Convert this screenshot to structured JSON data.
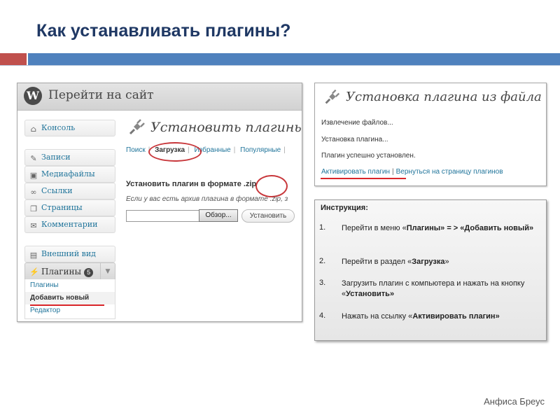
{
  "slide": {
    "title": "Как устанавливать плагины?",
    "author": "Анфиса Бреус",
    "colors": {
      "title": "#1f3864",
      "bar_red": "#c0504d",
      "bar_blue": "#4f81bd",
      "highlight": "#d9262a"
    }
  },
  "left_shot": {
    "logo_letter": "W",
    "site_link": "Перейти на сайт",
    "menu": [
      {
        "label": "Консоль",
        "icon": "dashboard-icon"
      },
      {
        "label": "Записи",
        "icon": "pin-icon"
      },
      {
        "label": "Медиафайлы",
        "icon": "media-icon"
      },
      {
        "label": "Ссылки",
        "icon": "links-icon"
      },
      {
        "label": "Страницы",
        "icon": "pages-icon"
      },
      {
        "label": "Комментарии",
        "icon": "comments-icon"
      },
      {
        "label": "Внешний вид",
        "icon": "appearance-icon"
      }
    ],
    "plugins_menu": {
      "label": "Плагины",
      "badge": "5"
    },
    "submenu": [
      "Плагины",
      "Добавить новый",
      "Редактор"
    ],
    "page_title": "Установить плагины",
    "tabs": [
      "Поиск",
      "Загрузка",
      "Избранные",
      "Популярные"
    ],
    "upload_heading": "Установить плагин в формате .zip",
    "upload_hint": "Если у вас есть архив плагина в формате .zip, з",
    "browse_button": "Обзор...",
    "install_button": "Установить"
  },
  "right_shot": {
    "title": "Установка плагина из файла",
    "lines": [
      "Извлечение файлов...",
      "Установка плагина...",
      "Плагин успешно установлен."
    ],
    "activate_link": "Активировать плагин",
    "separator": "|",
    "return_link": "Вернуться на страницу плагинов"
  },
  "instructions": {
    "heading": "Инструкция:",
    "steps": [
      {
        "num": "1.",
        "pre": "Перейти в меню «",
        "bold1": "Плагины",
        "mid": "» = > «",
        "bold2": "Добавить новый",
        "post": "»"
      },
      {
        "num": "2.",
        "pre": "Перейти в раздел «",
        "bold1": "Загрузка",
        "post": "»"
      },
      {
        "num": "3.",
        "pre": "Загрузить плагин с компьютера и нажать на кнопку «",
        "bold1": "Установить",
        "post": "»"
      },
      {
        "num": "4.",
        "pre": "Нажать на ссылку «",
        "bold1": "Активировать плагин",
        "post": "»"
      }
    ]
  }
}
